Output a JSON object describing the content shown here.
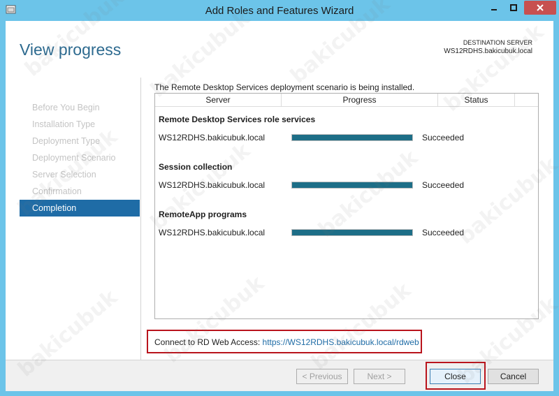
{
  "window": {
    "title": "Add Roles and Features Wizard"
  },
  "header": {
    "page_title": "View progress",
    "destination_label": "DESTINATION SERVER",
    "destination_server": "WS12RDHS.bakicubuk.local"
  },
  "nav": {
    "items": [
      {
        "label": "Before You Begin",
        "active": false
      },
      {
        "label": "Installation Type",
        "active": false
      },
      {
        "label": "Deployment Type",
        "active": false
      },
      {
        "label": "Deployment Scenario",
        "active": false
      },
      {
        "label": "Server Selection",
        "active": false
      },
      {
        "label": "Confirmation",
        "active": false
      },
      {
        "label": "Completion",
        "active": true
      }
    ]
  },
  "main": {
    "status_line": "The Remote Desktop Services deployment scenario is being installed.",
    "columns": [
      "Server",
      "Progress",
      "Status"
    ],
    "groups": [
      {
        "title": "Remote Desktop Services role services",
        "rows": [
          {
            "server": "WS12RDHS.bakicubuk.local",
            "progress": 1.0,
            "status": "Succeeded"
          }
        ]
      },
      {
        "title": "Session collection",
        "rows": [
          {
            "server": "WS12RDHS.bakicubuk.local",
            "progress": 1.0,
            "status": "Succeeded"
          }
        ]
      },
      {
        "title": "RemoteApp programs",
        "rows": [
          {
            "server": "WS12RDHS.bakicubuk.local",
            "progress": 1.0,
            "status": "Succeeded"
          }
        ]
      }
    ],
    "rdweb_label": "Connect to RD Web Access:",
    "rdweb_url": "https://WS12RDHS.bakicubuk.local/rdweb"
  },
  "footer": {
    "prev_label": "< Previous",
    "next_label": "Next >",
    "close_label": "Close",
    "cancel_label": "Cancel"
  },
  "watermark_text": "bakicubuk",
  "colors": {
    "titlebar": "#6cc4e9",
    "accent": "#1f6ca6",
    "progress_fill": "#1d6e87",
    "highlight": "#b9141c",
    "close_button": "#c75050"
  },
  "icons": [
    "app-icon",
    "minimize-icon",
    "maximize-icon",
    "close-icon"
  ]
}
